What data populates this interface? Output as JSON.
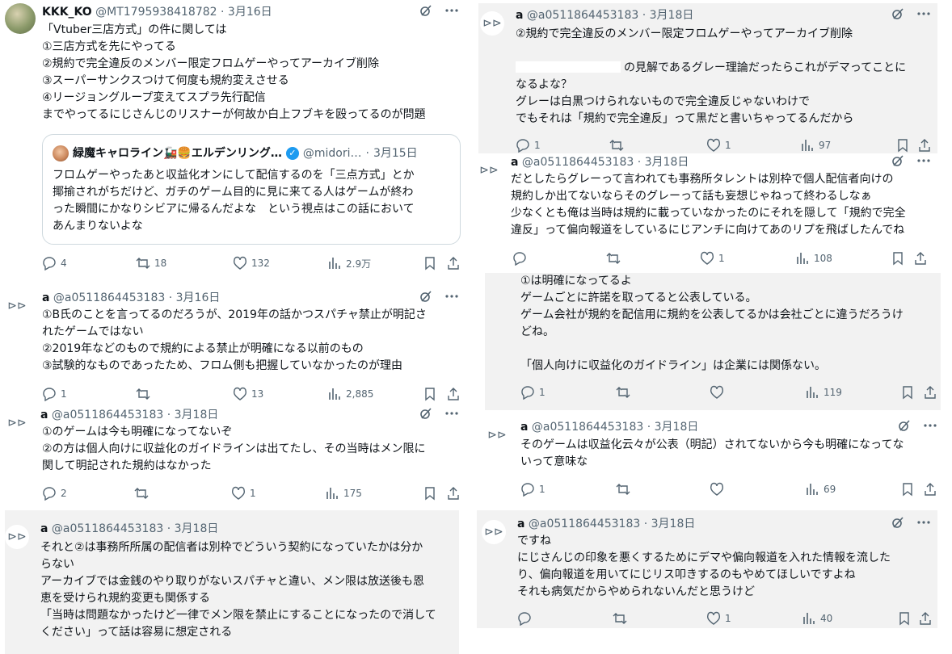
{
  "icons": {
    "reply": "reply-icon",
    "retweet": "retweet-icon",
    "like": "heart-icon",
    "views": "views-icon",
    "bookmark": "bookmark-icon",
    "share": "share-icon",
    "grok": "grok-icon",
    "more": "more-icon",
    "nav": "show-thread-icon"
  },
  "colors": {
    "verified": "#1d9bf0",
    "muted": "#536471",
    "background_gray": "#f2f2f2"
  },
  "tweets": [
    {
      "name": "KKK_KO",
      "handle": "@MT1795938418782",
      "sep": "·",
      "date": "3月16日",
      "lines": [
        "「Vtuber三店方式」の件に関しては",
        "①三店方式を先にやってる",
        "②規約で完全違反のメンバー限定フロムゲーやってアーカイブ削除",
        "③スーパーサンクスつけて何度も規約変えさせる",
        "④リージョングループ変えてスプラ先行配信",
        "までやってるにじさんじのリスナーが何故か白上フブキを殴ってるのが問題"
      ],
      "quote": {
        "name": "緑魔キャロライン🚂🍔エルデンリング…",
        "verified": "✓",
        "handle": "@midori…",
        "sep": "·",
        "date": "3月15日",
        "lines": [
          "フロムゲーやったあと収益化オンにして配信するのを「三点方式」とか",
          "揶揄されがちだけど、ガチのゲーム目的に見に来てる人はゲームが終わ",
          "った瞬間にかなりシビアに帰るんだよな　という視点はこの話において",
          "あんまりないよな"
        ]
      },
      "stats": {
        "replies": "4",
        "retweets": "18",
        "likes": "132",
        "views": "2.9万"
      }
    },
    {
      "name": "a",
      "handle": "@a0511864453183",
      "sep": "·",
      "date": "3月16日",
      "lines": [
        "①B氏のことを言ってるのだろうが、2019年の話かつスパチャ禁止が明記さ",
        "れたゲームではない",
        "②2019年などのもので規約による禁止が明確になる以前のもの",
        "③試験的なものであったため、フロム側も把握していなかったのが理由"
      ],
      "stats": {
        "replies": "1",
        "retweets": "",
        "likes": "13",
        "views": "2,885"
      }
    },
    {
      "name": "a",
      "handle": "@a0511864453183",
      "sep": "·",
      "date": "3月18日",
      "lines": [
        "①のゲームは今も明確になってないぞ",
        "②の方は個人向けに収益化のガイドラインは出てたし、その当時はメン限に",
        "関して明記された規約はなかった"
      ],
      "stats": {
        "replies": "2",
        "retweets": "",
        "likes": "1",
        "views": "175"
      }
    },
    {
      "name": "a",
      "handle": "@a0511864453183",
      "sep": "·",
      "date": "3月18日",
      "lines": [
        "それと②は事務所所属の配信者は別枠でどういう契約になっていたかは分か",
        "らない",
        "アーカイブでは金銭のやり取りがないスパチャと違い、メン限は放送後も恩",
        "恵を受けられ規約変更も関係する",
        "「当時は問題なかったけど一律でメン限を禁止にすることになったので消して",
        "ください」って話は容易に想定される"
      ]
    },
    {
      "name": "a",
      "handle": "@a0511864453183",
      "sep": "·",
      "date": "3月18日",
      "lines": [
        "②規約で完全違反のメンバー限定フロムゲーやってアーカイブ削除",
        "",
        "の見解であるグレー理論だったらこれがデマってことに",
        "なるよな？",
        "グレーは白黒つけられないもので完全違反じゃないわけで",
        "でもそれは「規約で完全違反」って黒だと書いちゃってるんだから"
      ],
      "stats": {
        "replies": "1",
        "retweets": "",
        "likes": "1",
        "views": "97"
      }
    },
    {
      "name": "a",
      "handle": "@a0511864453183",
      "sep": "·",
      "date": "3月18日",
      "lines": [
        "だとしたらグレーって言われても事務所タレントは別枠で個人配信者向けの",
        "規約しか出てないならそのグレーって話も妄想じゃねって終わるしなぁ",
        "少なくとも俺は当時は規約に載っていなかったのにそれを隠して「規約で完全",
        "違反」って偏向報道をしているにじアンチに向けてあのリプを飛ばしたんでね"
      ],
      "stats": {
        "replies": "",
        "retweets": "",
        "likes": "1",
        "views": "108"
      }
    },
    {
      "lines": [
        "①は明確になってるよ",
        "ゲームごとに許諾を取ってると公表している。",
        "ゲーム会社が規約を配信用に規約を公表してるかは会社ごとに違うだろうけ",
        "どね。",
        "",
        "「個人向けに収益化のガイドライン」は企業には関係ない。"
      ],
      "stats": {
        "replies": "1",
        "retweets": "",
        "likes": "",
        "views": "119"
      }
    },
    {
      "name": "a",
      "handle": "@a0511864453183",
      "sep": "·",
      "date": "3月18日",
      "lines": [
        "そのゲームは収益化云々が公表（明記）されてないから今も明確になってな",
        "いって意味な"
      ],
      "stats": {
        "replies": "1",
        "retweets": "",
        "likes": "",
        "views": "69"
      }
    },
    {
      "name": "a",
      "handle": "@a0511864453183",
      "sep": "·",
      "date": "3月18日",
      "lines": [
        "ですね",
        "にじさんじの印象を悪くするためにデマや偏向報道を入れた情報を流した",
        "り、偏向報道を用いてにじリス叩きするのもやめてほしいですよね",
        "それも病気だからやめられないんだと思うけど"
      ],
      "stats": {
        "replies": "",
        "retweets": "",
        "likes": "1",
        "views": "40"
      }
    }
  ]
}
